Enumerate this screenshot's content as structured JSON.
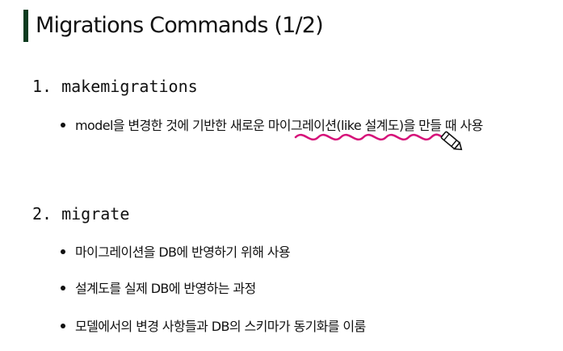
{
  "slide": {
    "title": "Migrations Commands (1/2)",
    "sections": [
      {
        "number": "1.",
        "heading": "makemigrations",
        "bullets": [
          "model을 변경한 것에 기반한 새로운 마이그레이션(like 설계도)을 만들 때 사용"
        ]
      },
      {
        "number": "2.",
        "heading": "migrate",
        "bullets": [
          "마이그레이션을 DB에 반영하기 위해 사용",
          "설계도를 실제 DB에 반영하는 과정",
          "모델에서의 변경 사항들과 DB의 스키마가 동기화를 이룸"
        ]
      }
    ]
  },
  "annotation": {
    "color": "#d6137a",
    "icon": "pen-cursor-icon"
  },
  "colors": {
    "accent_bar": "#0c3b1f",
    "text": "#111111"
  }
}
